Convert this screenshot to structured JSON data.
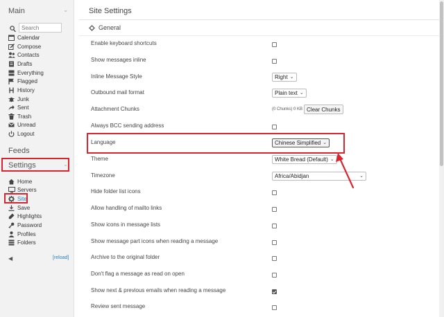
{
  "colors": {
    "accent": "#2a7fb8",
    "highlight": "#d9232e"
  },
  "sidebar": {
    "main_title": "Main",
    "search_placeholder": "Search",
    "main_items": [
      {
        "label": "Calendar",
        "icon": "calendar-icon"
      },
      {
        "label": "Compose",
        "icon": "compose-icon"
      },
      {
        "label": "Contacts",
        "icon": "contacts-icon"
      },
      {
        "label": "Drafts",
        "icon": "drafts-icon"
      },
      {
        "label": "Everything",
        "icon": "everything-icon"
      },
      {
        "label": "Flagged",
        "icon": "flag-icon"
      },
      {
        "label": "History",
        "icon": "history-icon"
      },
      {
        "label": "Junk",
        "icon": "junk-icon"
      },
      {
        "label": "Sent",
        "icon": "sent-icon"
      },
      {
        "label": "Trash",
        "icon": "trash-icon"
      },
      {
        "label": "Unread",
        "icon": "unread-icon"
      },
      {
        "label": "Logout",
        "icon": "logout-icon"
      }
    ],
    "feeds_title": "Feeds",
    "settings_title": "Settings",
    "settings_items": [
      {
        "label": "Home",
        "icon": "home-icon"
      },
      {
        "label": "Servers",
        "icon": "servers-icon"
      },
      {
        "label": "Site",
        "icon": "gear-icon",
        "active": true
      },
      {
        "label": "Save",
        "icon": "save-icon"
      },
      {
        "label": "Highlights",
        "icon": "highlights-icon"
      },
      {
        "label": "Password",
        "icon": "key-icon"
      },
      {
        "label": "Profiles",
        "icon": "profiles-icon"
      },
      {
        "label": "Folders",
        "icon": "folders-icon"
      }
    ],
    "reload_label": "[reload]"
  },
  "main": {
    "title": "Site Settings",
    "group_title": "General",
    "rows": {
      "keyboard_shortcuts": "Enable keyboard shortcuts",
      "messages_inline": "Show messages inline",
      "inline_style": {
        "label": "Inline Message Style",
        "value": "Right"
      },
      "outbound_format": {
        "label": "Outbound mail format",
        "value": "Plain text"
      },
      "attachment_chunks": {
        "label": "Attachment Chunks",
        "info": "(0 Chunks) 0 KB",
        "button": "Clear Chunks"
      },
      "always_bcc": "Always BCC sending address",
      "language": {
        "label": "Language",
        "value": "Chinese Simplified"
      },
      "theme": {
        "label": "Theme",
        "value": "White Bread (Default)"
      },
      "timezone": {
        "label": "Timezone",
        "value": "Africa/Abidjan"
      },
      "hide_folder_icons": "Hide folder list icons",
      "mailto_links": "Allow handling of mailto links",
      "icons_message_lists": "Show icons in message lists",
      "part_icons": "Show message part icons when reading a message",
      "archive_original": "Archive to the original folder",
      "dont_flag_read": "Don't flag a message as read on open",
      "next_prev": "Show next & previous emails when reading a message",
      "review_sent": "Review sent message"
    },
    "checked": {
      "next_prev": true
    }
  }
}
